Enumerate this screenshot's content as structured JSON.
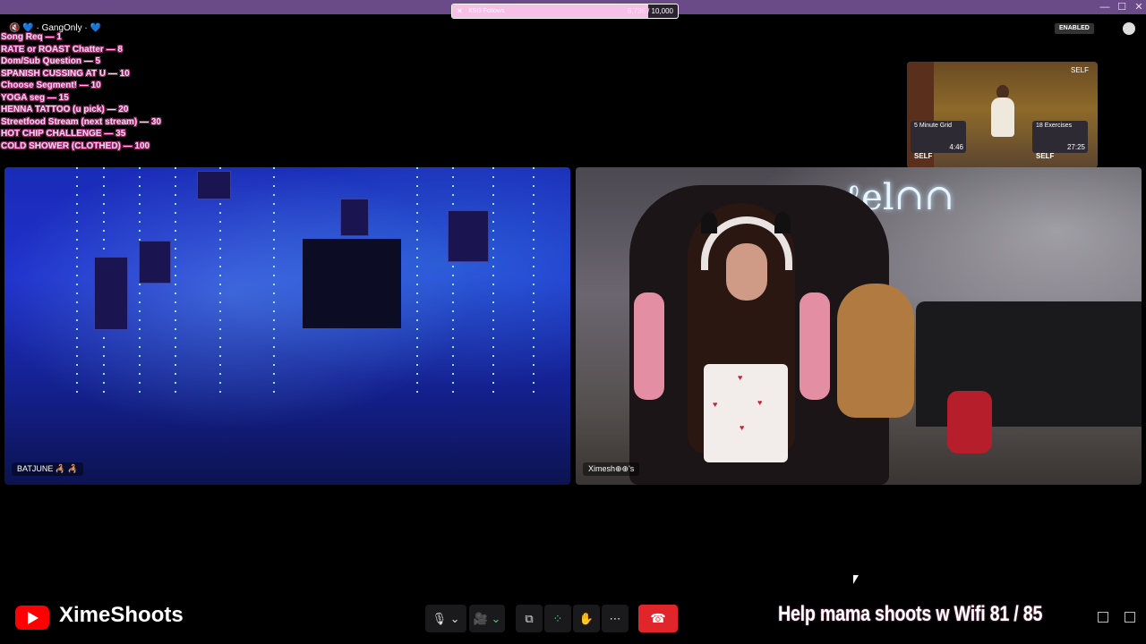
{
  "window": {
    "controls": [
      "—",
      "☐",
      "✕"
    ]
  },
  "follow_goal": {
    "label": "XSG Follows",
    "current": "8,736",
    "target": "10,000",
    "progress": 0.87
  },
  "menu": {
    "header": "🔇 💙 · GangOnly · 💙",
    "items": [
      "Song Req — 1",
      "RATE or ROAST Chatter — 8",
      "Dom/Sub Question — 5",
      "SPANISH CUSSING AT U — 10",
      "Choose Segment! — 10",
      "YOGA seg — 15",
      "HENNA TATTOO (u pick) — 20",
      "Streetfood Stream (next stream) — 30",
      "HOT CHIP CHALLENGE — 35",
      "COLD SHOWER (CLOTHED) — 100"
    ]
  },
  "status": {
    "enabled_label": "ENABLED"
  },
  "pip": {
    "self_label": "SELF",
    "thumbs": [
      {
        "title": "5 Minute Grid",
        "duration": "4:46",
        "self_label": "SELF"
      },
      {
        "title": "18 Exercises",
        "duration": "27:25",
        "self_label": "SELF"
      }
    ]
  },
  "participants": [
    {
      "name": "BATJUNE 🦂 🦂"
    },
    {
      "name": "Ximesh⊕⊕'s"
    }
  ],
  "channel": {
    "name": "XimeShoots"
  },
  "wifi_goal": {
    "text": "Help mama shoots w Wifi",
    "current": "81",
    "total": "85",
    "display": "Help mama shoots w Wifi  81 / 85"
  },
  "toolbar": {
    "mic_icon": "🎙",
    "chevron": "⌄",
    "camera_icon": "🎥",
    "share_icon": "⧉",
    "apps_icon": "⁘",
    "reactions_icon": "✋",
    "more_icon": "⋯",
    "leave_icon": "☎"
  },
  "colors": {
    "titlebar": "#6b4a8a",
    "leave": "#e0252b",
    "youtube": "#ff0000",
    "menu_text": "#ffd6ee"
  }
}
